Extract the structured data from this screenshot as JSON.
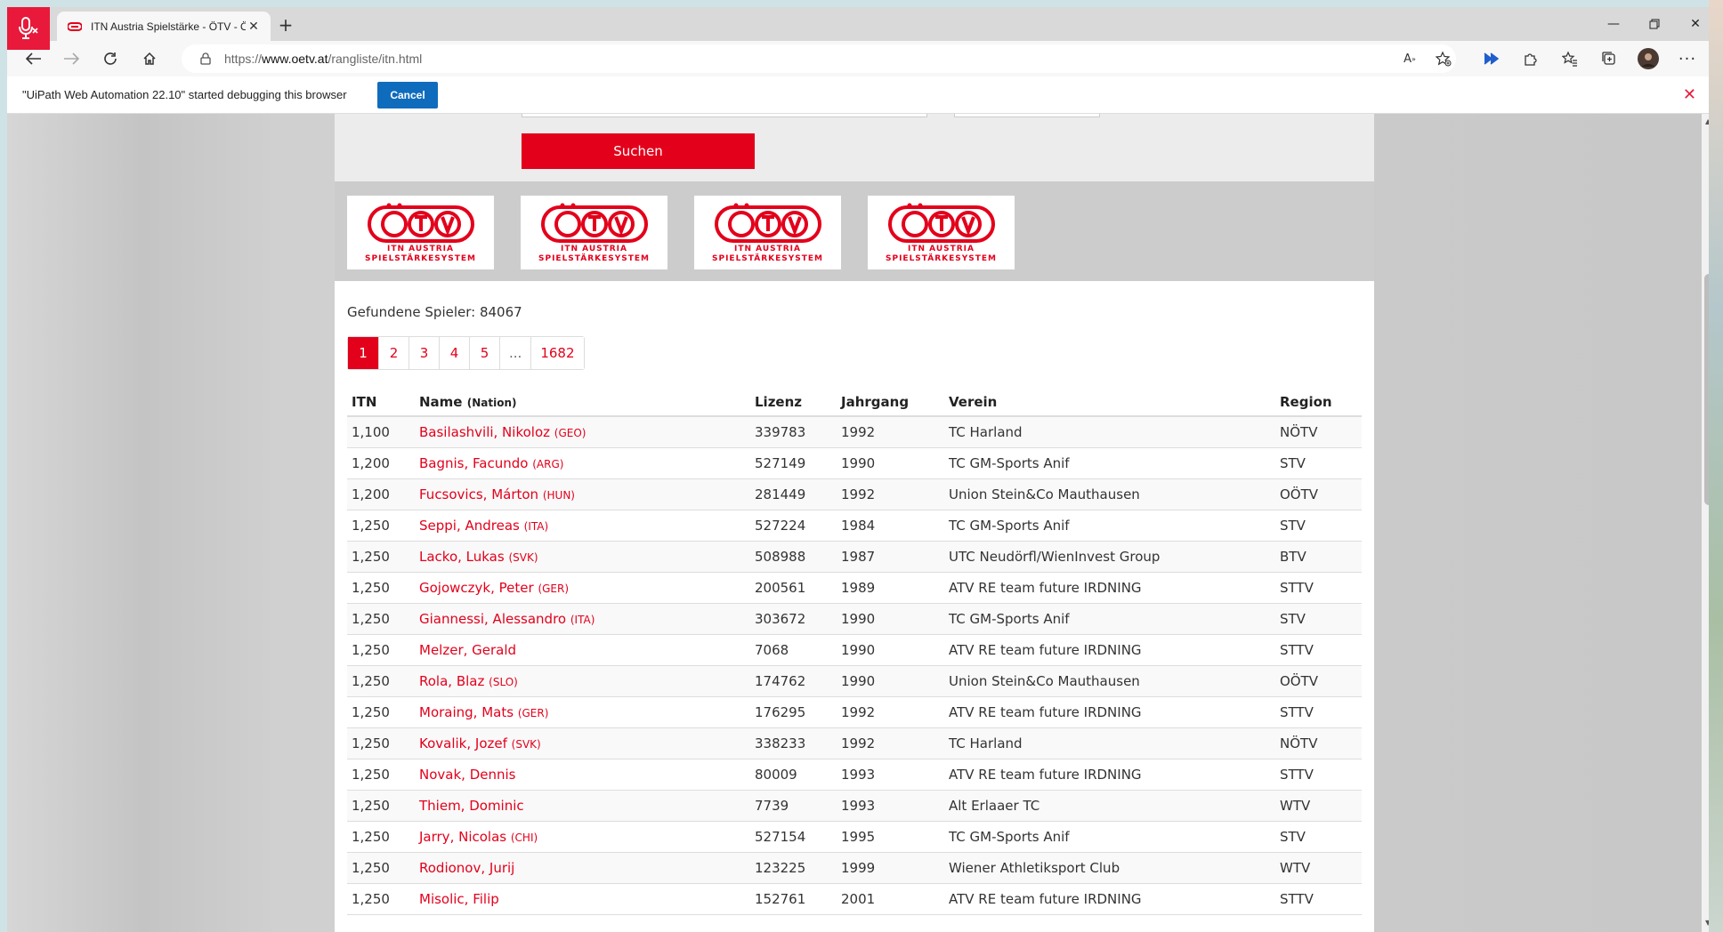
{
  "browser": {
    "tab_title": "ITN Austria Spielstärke - ÖTV - Ö",
    "url_prefix": "https://",
    "url_host": "www.oetv.at",
    "url_path": "/rangliste/itn.html"
  },
  "infobar": {
    "message": "\"UiPath Web Automation 22.10\" started debugging this browser",
    "cancel_label": "Cancel"
  },
  "search": {
    "button_label": "Suchen"
  },
  "logos": [
    {
      "line1": "ITN AUSTRIA",
      "line2": "SPIELSTÄRKESYSTEM"
    },
    {
      "line1": "ITN AUSTRIA",
      "line2": "SPIELSTÄRKESYSTEM"
    },
    {
      "line1": "ITN AUSTRIA",
      "line2": "SPIELSTÄRKESYSTEM"
    },
    {
      "line1": "ITN AUSTRIA",
      "line2": "SPIELSTÄRKESYSTEM"
    }
  ],
  "results": {
    "found_text": "Gefundene Spieler: 84067",
    "pages": [
      "1",
      "2",
      "3",
      "4",
      "5",
      "...",
      "1682"
    ],
    "active_page": "1",
    "headers": {
      "itn": "ITN",
      "name": "Name",
      "nation": "(Nation)",
      "lizenz": "Lizenz",
      "jahrgang": "Jahrgang",
      "verein": "Verein",
      "region": "Region"
    },
    "rows": [
      {
        "itn": "1,100",
        "name": "Basilashvili, Nikoloz",
        "nation": "(GEO)",
        "lizenz": "339783",
        "jahrgang": "1992",
        "verein": "TC Harland",
        "region": "NÖTV"
      },
      {
        "itn": "1,200",
        "name": "Bagnis, Facundo",
        "nation": "(ARG)",
        "lizenz": "527149",
        "jahrgang": "1990",
        "verein": "TC GM-Sports Anif",
        "region": "STV"
      },
      {
        "itn": "1,200",
        "name": "Fucsovics, Márton",
        "nation": "(HUN)",
        "lizenz": "281449",
        "jahrgang": "1992",
        "verein": "Union Stein&Co Mauthausen",
        "region": "OÖTV"
      },
      {
        "itn": "1,250",
        "name": "Seppi, Andreas",
        "nation": "(ITA)",
        "lizenz": "527224",
        "jahrgang": "1984",
        "verein": "TC GM-Sports Anif",
        "region": "STV"
      },
      {
        "itn": "1,250",
        "name": "Lacko, Lukas",
        "nation": "(SVK)",
        "lizenz": "508988",
        "jahrgang": "1987",
        "verein": "UTC Neudörfl/WienInvest Group",
        "region": "BTV"
      },
      {
        "itn": "1,250",
        "name": "Gojowczyk, Peter",
        "nation": "(GER)",
        "lizenz": "200561",
        "jahrgang": "1989",
        "verein": "ATV RE team future IRDNING",
        "region": "STTV"
      },
      {
        "itn": "1,250",
        "name": "Giannessi, Alessandro",
        "nation": "(ITA)",
        "lizenz": "303672",
        "jahrgang": "1990",
        "verein": "TC GM-Sports Anif",
        "region": "STV"
      },
      {
        "itn": "1,250",
        "name": "Melzer, Gerald",
        "nation": "",
        "lizenz": "7068",
        "jahrgang": "1990",
        "verein": "ATV RE team future IRDNING",
        "region": "STTV"
      },
      {
        "itn": "1,250",
        "name": "Rola, Blaz",
        "nation": "(SLO)",
        "lizenz": "174762",
        "jahrgang": "1990",
        "verein": "Union Stein&Co Mauthausen",
        "region": "OÖTV"
      },
      {
        "itn": "1,250",
        "name": "Moraing, Mats",
        "nation": "(GER)",
        "lizenz": "176295",
        "jahrgang": "1992",
        "verein": "ATV RE team future IRDNING",
        "region": "STTV"
      },
      {
        "itn": "1,250",
        "name": "Kovalik, Jozef",
        "nation": "(SVK)",
        "lizenz": "338233",
        "jahrgang": "1992",
        "verein": "TC Harland",
        "region": "NÖTV"
      },
      {
        "itn": "1,250",
        "name": "Novak, Dennis",
        "nation": "",
        "lizenz": "80009",
        "jahrgang": "1993",
        "verein": "ATV RE team future IRDNING",
        "region": "STTV"
      },
      {
        "itn": "1,250",
        "name": "Thiem, Dominic",
        "nation": "",
        "lizenz": "7739",
        "jahrgang": "1993",
        "verein": "Alt Erlaaer TC",
        "region": "WTV"
      },
      {
        "itn": "1,250",
        "name": "Jarry, Nicolas",
        "nation": "(CHI)",
        "lizenz": "527154",
        "jahrgang": "1995",
        "verein": "TC GM-Sports Anif",
        "region": "STV"
      },
      {
        "itn": "1,250",
        "name": "Rodionov, Jurij",
        "nation": "",
        "lizenz": "123225",
        "jahrgang": "1999",
        "verein": "Wiener Athletiksport Club",
        "region": "WTV"
      },
      {
        "itn": "1,250",
        "name": "Misolic, Filip",
        "nation": "",
        "lizenz": "152761",
        "jahrgang": "2001",
        "verein": "ATV RE team future IRDNING",
        "region": "STTV"
      }
    ]
  },
  "colors": {
    "brand_red": "#e3001b",
    "debug_blue": "#0f6cbd"
  },
  "icons": [
    "microphone-muted-icon",
    "tab-favicon-icon",
    "close-icon",
    "plus-icon",
    "minimize-icon",
    "restore-icon",
    "back-icon",
    "forward-icon",
    "refresh-icon",
    "home-icon",
    "lock-icon",
    "read-aloud-icon",
    "favorite-add-icon",
    "extension-icon",
    "puzzle-icon",
    "favorites-icon",
    "collections-icon",
    "profile-avatar",
    "more-icon"
  ]
}
